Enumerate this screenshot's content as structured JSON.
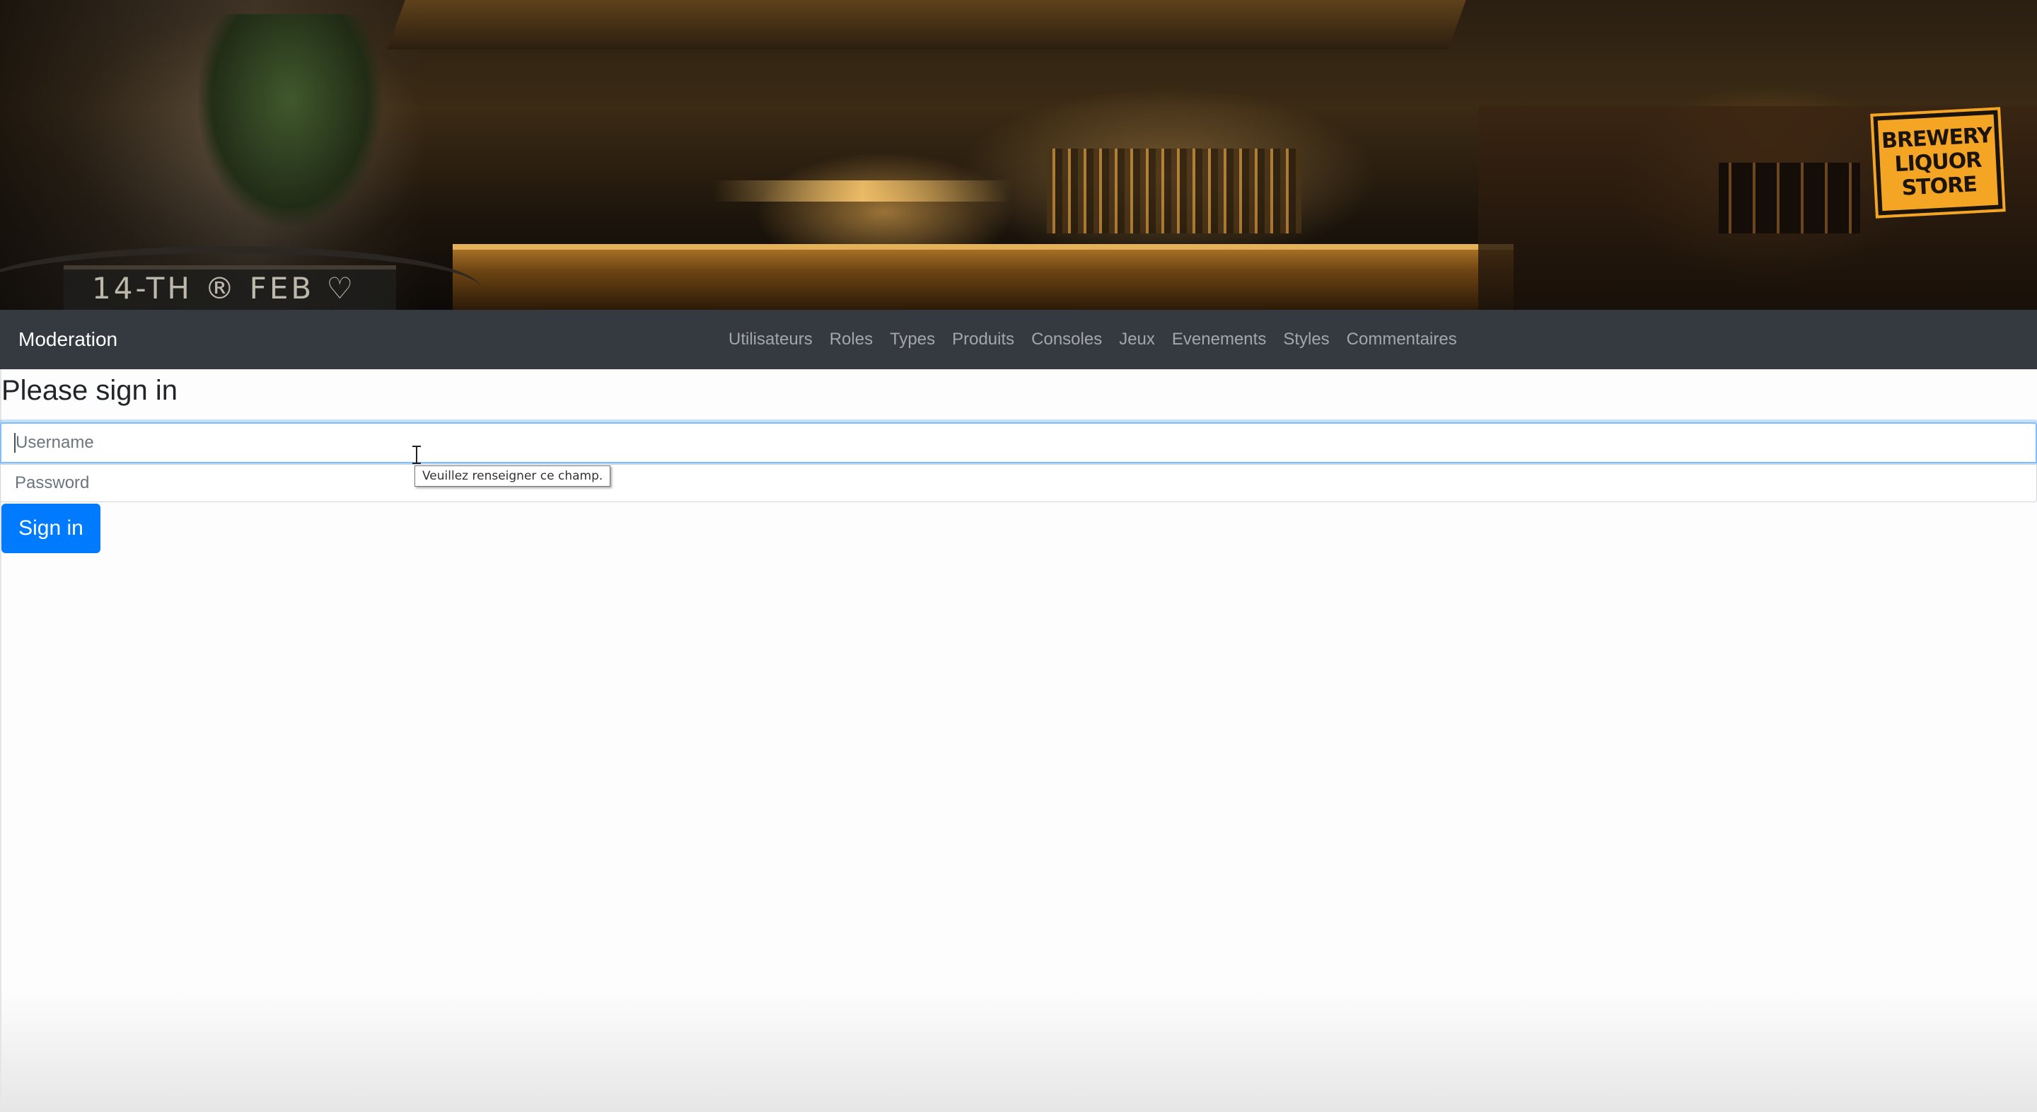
{
  "hero": {
    "sign_line1": "BREWERY",
    "sign_line2": "LIQUOR",
    "sign_line3": "STORE",
    "chalkboard": "14-TH  ® FEB ♡"
  },
  "navbar": {
    "brand": "Moderation",
    "links": [
      "Utilisateurs",
      "Roles",
      "Types",
      "Produits",
      "Consoles",
      "Jeux",
      "Evenements",
      "Styles",
      "Commentaires"
    ],
    "background_color": "#343a40"
  },
  "form": {
    "title": "Please sign in",
    "username_placeholder": "Username",
    "password_placeholder": "Password",
    "validation_tooltip": "Veuillez renseigner ce champ.",
    "submit_label": "Sign in",
    "accent_color": "#007bff"
  }
}
